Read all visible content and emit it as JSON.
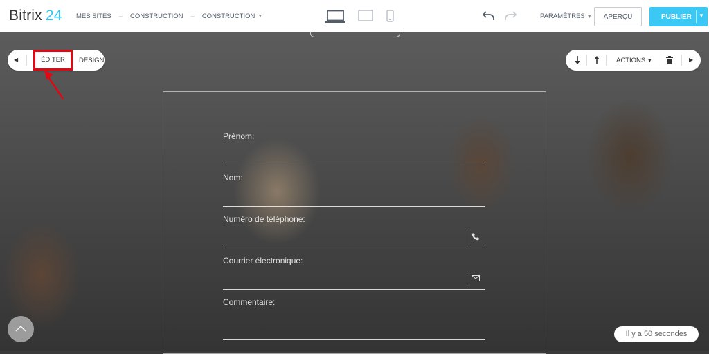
{
  "header": {
    "logo_name": "Bitrix",
    "logo_number": "24",
    "breadcrumbs": [
      "MES SITES",
      "CONSTRUCTION",
      "CONSTRUCTION"
    ],
    "settings_label": "PARAMÈTRES",
    "preview_label": "APERÇU",
    "publish_label": "PUBLIER",
    "accent_color": "#3bc8f5"
  },
  "block_toolbar": {
    "edit_label": "ÉDITER",
    "design_label": "DESIGN",
    "actions_label": "ACTIONS"
  },
  "form": {
    "fields": [
      {
        "label": "Prénom:"
      },
      {
        "label": "Nom:"
      },
      {
        "label": "Numéro de téléphone:",
        "icon": "phone-icon"
      },
      {
        "label": "Courrier électronique:",
        "icon": "envelope-icon"
      },
      {
        "label": "Commentaire:"
      }
    ]
  },
  "status": {
    "saved_text": "Il y a 50 secondes"
  },
  "highlight_color": "#e30613"
}
